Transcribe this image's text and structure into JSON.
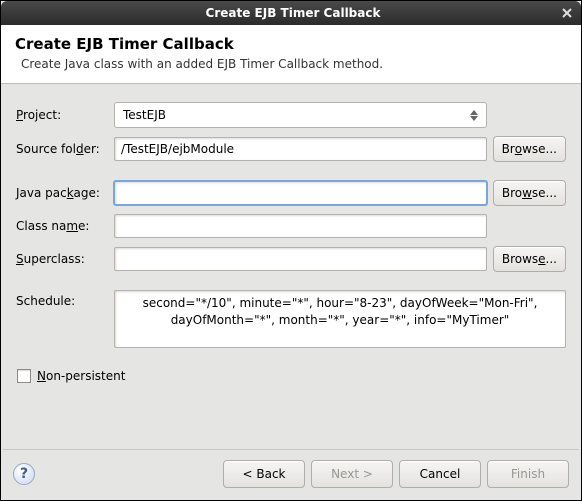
{
  "titlebar": {
    "title": "Create EJB Timer Callback"
  },
  "header": {
    "heading": "Create EJB Timer Callback",
    "description": "Create Java class with an added EJB Timer Callback method."
  },
  "labels": {
    "project": "Project:",
    "source_folder": "Source folder:",
    "java_package": "Java package:",
    "class_name": "Class name:",
    "superclass": "Superclass:",
    "schedule": "Schedule:",
    "non_persistent": "Non-persistent"
  },
  "fields": {
    "project": "TestEJB",
    "source_folder": "/TestEJB/ejbModule",
    "java_package": "",
    "class_name": "",
    "superclass": "",
    "schedule": "second=\"*/10\", minute=\"*\", hour=\"8-23\", dayOfWeek=\"Mon-Fri\", dayOfMonth=\"*\", month=\"*\", year=\"*\", info=\"MyTimer\"",
    "non_persistent": false
  },
  "buttons": {
    "browse": "Browse...",
    "back": "< Back",
    "next": "Next >",
    "cancel": "Cancel",
    "finish": "Finish",
    "help": "?"
  }
}
